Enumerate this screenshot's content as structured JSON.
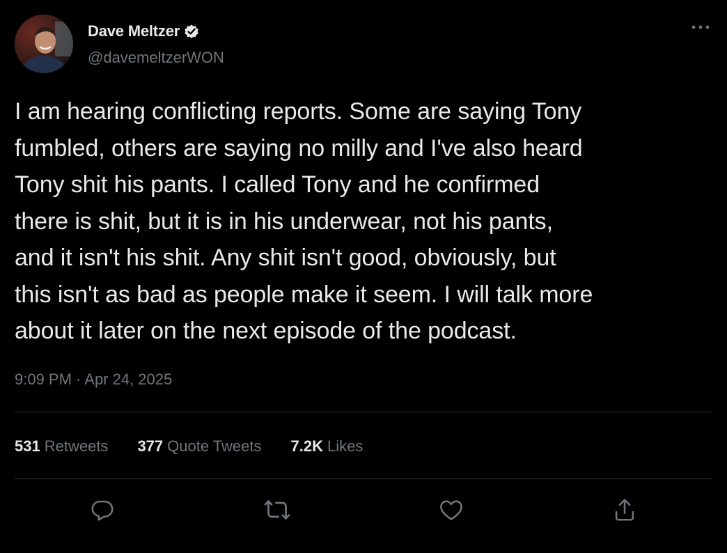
{
  "author": {
    "display_name": "Dave Meltzer",
    "handle": "@davemeltzerWON",
    "verified": true,
    "avatar_icon": "avatar-photo"
  },
  "tweet": {
    "text": "I am hearing conflicting reports. Some are saying Tony\nfumbled, others are saying no milly and I've also heard\nTony shit his pants. I called Tony and he confirmed\nthere is shit, but it is in his underwear, not his pants,\nand it isn't his shit. Any shit isn't good, obviously, but\nthis isn't as bad as people make it seem. I will talk more\nabout it later on the next episode of the podcast.",
    "timestamp": "9:09 PM · Apr 24, 2025"
  },
  "stats": {
    "retweets_count": "531",
    "retweets_label": "Retweets",
    "quotes_count": "377",
    "quotes_label": "Quote Tweets",
    "likes_count": "7.2K",
    "likes_label": "Likes"
  },
  "actions": {
    "reply_icon": "reply-icon",
    "retweet_icon": "retweet-icon",
    "like_icon": "heart-icon",
    "share_icon": "share-icon"
  },
  "colors": {
    "background": "#000000",
    "primary_text": "#e7e9ea",
    "secondary_text": "#71767b",
    "divider": "#2f3336"
  }
}
